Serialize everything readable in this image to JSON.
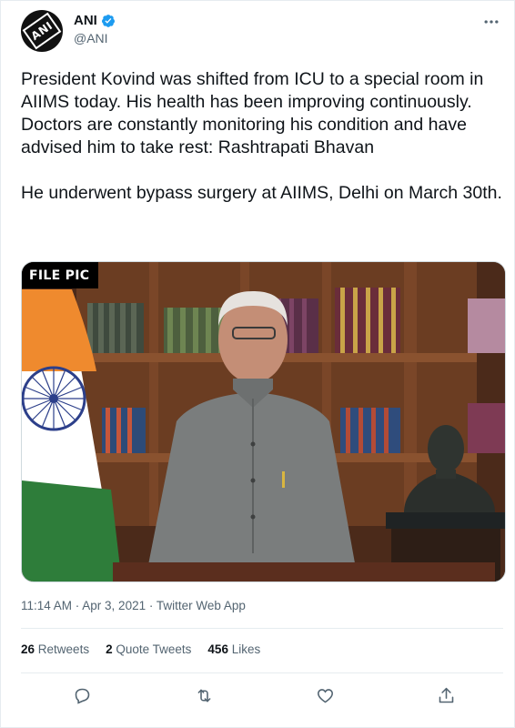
{
  "author": {
    "display_name": "ANI",
    "handle": "@ANI",
    "avatar_label": "ANI",
    "avatar_icon": "ani-logo",
    "verified_icon": "verified-badge-icon"
  },
  "tweet": {
    "paragraphs": [
      "President Kovind was shifted from ICU to a special room in AIIMS today. His health has been improving continuously. Doctors are constantly monitoring his condition and have advised him to take rest: Rashtrapati Bhavan",
      "He underwent bypass surgery at AIIMS, Delhi on March 30th."
    ],
    "media_badge": "FILE PIC",
    "timestamp": "11:14 AM · Apr 3, 2021 · Twitter Web App"
  },
  "stats": {
    "retweets_count": "26",
    "retweets_label": "Retweets",
    "quotes_count": "2",
    "quotes_label": "Quote Tweets",
    "likes_count": "456",
    "likes_label": "Likes"
  },
  "actions": {
    "reply_icon": "reply-icon",
    "retweet_icon": "retweet-icon",
    "like_icon": "heart-icon",
    "share_icon": "share-icon",
    "more_icon": "more-icon"
  },
  "colors": {
    "text": "#0f1419",
    "secondary": "#536471",
    "verified": "#1d9bf0",
    "border": "#e6ecf0"
  }
}
